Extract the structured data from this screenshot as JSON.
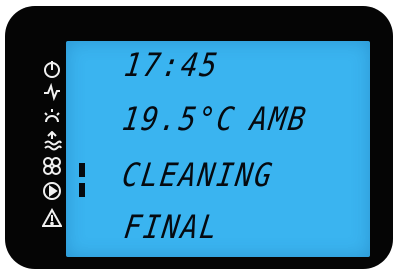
{
  "display": {
    "time": "17:45",
    "temperature": "19.5°C",
    "temperature_label": "AMB",
    "mode": "CLEANING",
    "stage": "FINAL"
  },
  "icons": [
    "power-timer-icon",
    "lightning-icon",
    "brightness-icon",
    "steam-icon",
    "fan-icon",
    "play-icon",
    "warning-icon"
  ],
  "colors": {
    "screen_background": "#3ab4f0",
    "segment_text": "#050a10",
    "bezel": "#050505",
    "icon_stroke": "#f0f0f0"
  }
}
